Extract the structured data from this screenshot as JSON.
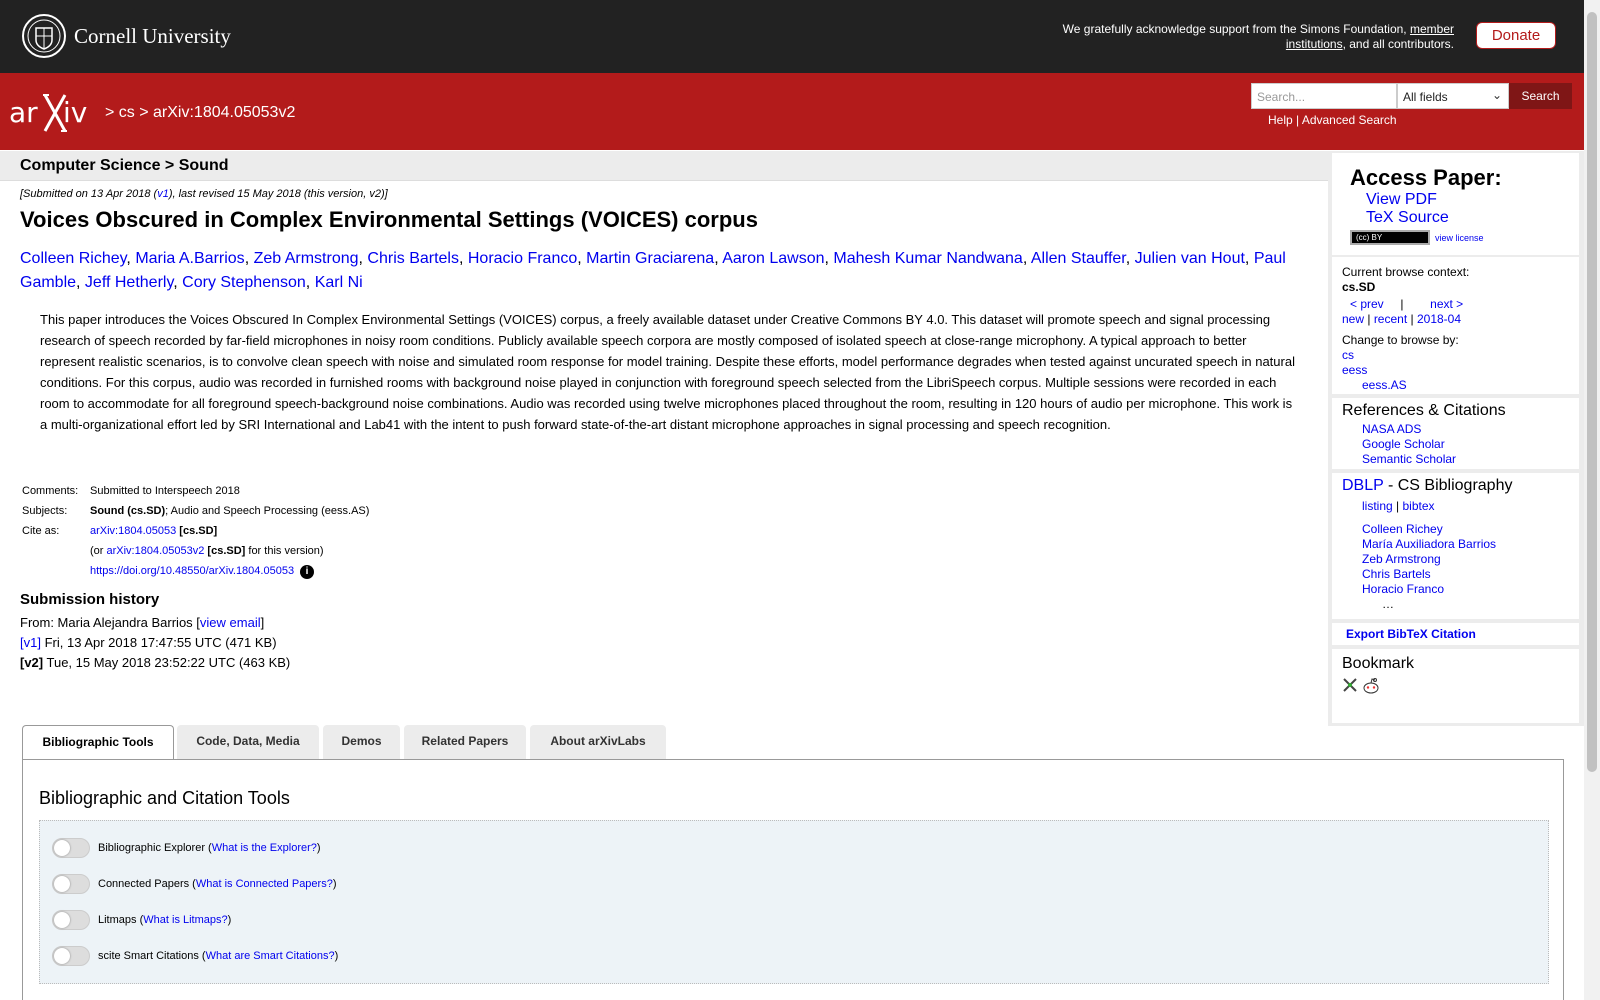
{
  "header": {
    "university": "Cornell University",
    "support_text_1": "We gratefully acknowledge support from the Simons Foundation,",
    "support_link": "member institutions",
    "support_text_2": ", and all contributors.",
    "donate": "Donate"
  },
  "nav": {
    "breadcrumbs": "> cs > arXiv:1804.05053v2",
    "search_placeholder": "Search...",
    "search_field": "All fields",
    "search_button": "Search",
    "help": "Help",
    "separator": "|",
    "advanced": "Advanced Search"
  },
  "subject": "Computer Science > Sound",
  "dateline": {
    "pre": "[Submitted on 13 Apr 2018 (",
    "v1": "v1",
    "post": "), last revised 15 May 2018 (this version, v2)]"
  },
  "title": "Voices Obscured in Complex Environmental Settings (VOICES) corpus",
  "authors": [
    "Colleen Richey",
    "Maria A.Barrios",
    "Zeb Armstrong",
    "Chris Bartels",
    "Horacio Franco",
    "Martin Graciarena",
    "Aaron Lawson",
    "Mahesh Kumar Nandwana",
    "Allen Stauffer",
    "Julien van Hout",
    "Paul Gamble",
    "Jeff Hetherly",
    "Cory Stephenson",
    "Karl Ni"
  ],
  "abstract": "This paper introduces the Voices Obscured In Complex Environmental Settings (VOICES) corpus, a freely available dataset under Creative Commons BY 4.0. This dataset will promote speech and signal processing research of speech recorded by far-field microphones in noisy room conditions. Publicly available speech corpora are mostly composed of isolated speech at close-range microphony. A typical approach to better represent realistic scenarios, is to convolve clean speech with noise and simulated room response for model training. Despite these efforts, model performance degrades when tested against uncurated speech in natural conditions. For this corpus, audio was recorded in furnished rooms with background noise played in conjunction with foreground speech selected from the LibriSpeech corpus. Multiple sessions were recorded in each room to accommodate for all foreground speech-background noise combinations. Audio was recorded using twelve microphones placed throughout the room, resulting in 120 hours of audio per microphone. This work is a multi-organizational effort led by SRI International and Lab41 with the intent to push forward state-of-the-art distant microphone approaches in signal processing and speech recognition.",
  "meta": {
    "comments_label": "Comments:",
    "comments": "Submitted to Interspeech 2018",
    "subjects_label": "Subjects:",
    "subject_primary": "Sound (cs.SD)",
    "subject_rest": "; Audio and Speech Processing (eess.AS)",
    "cite_label": "Cite as:",
    "cite_id": "arXiv:1804.05053",
    "cite_cat": "[cs.SD]",
    "cite2_pre": "(or ",
    "cite2_id": "arXiv:1804.05053v2",
    "cite2_cat": "[cs.SD]",
    "cite2_post": " for this version)",
    "doi": "https://doi.org/10.48550/arXiv.1804.05053"
  },
  "history": {
    "title": "Submission history",
    "from_pre": "From: Maria Alejandra Barrios [",
    "view_email": "view email",
    "from_post": "]",
    "v1_label": "[v1]",
    "v1_info": " Fri, 13 Apr 2018 17:47:55 UTC (471 KB)",
    "v2_label": "[v2]",
    "v2_info": " Tue, 15 May 2018 23:52:22 UTC (463 KB)"
  },
  "tabs": [
    "Bibliographic Tools",
    "Code, Data, Media",
    "Demos",
    "Related Papers",
    "About arXivLabs"
  ],
  "panel": {
    "title": "Bibliographic and Citation Tools",
    "tools": [
      {
        "name": "Bibliographic Explorer",
        "link": "What is the Explorer?"
      },
      {
        "name": "Connected Papers",
        "link": "What is Connected Papers?"
      },
      {
        "name": "Litmaps",
        "link": "What is Litmaps?"
      },
      {
        "name": "scite Smart Citations",
        "link": "What are Smart Citations?"
      }
    ]
  },
  "sidebar": {
    "access_title": "Access Paper:",
    "view_pdf": "View PDF",
    "tex_source": "TeX Source",
    "cc": "(cc) BY",
    "view_license": "view license",
    "context_label": "Current browse context:",
    "context": "cs.SD",
    "prev": "< prev",
    "pipe": "|",
    "next": "next >",
    "new": "new",
    "recent": "recent",
    "month": "2018-04",
    "change_label": "Change to browse by:",
    "browse": [
      "cs",
      "eess",
      "eess.AS"
    ],
    "refs_title": "References & Citations",
    "refs": [
      "NASA ADS",
      "Google Scholar",
      "Semantic Scholar"
    ],
    "dblp": "DBLP",
    "dblp_rest": " - CS Bibliography",
    "listing": "listing",
    "bibtex": "bibtex",
    "dblp_authors": [
      "Colleen Richey",
      "María Auxiliadora Barrios",
      "Zeb Armstrong",
      "Chris Bartels",
      "Horacio Franco"
    ],
    "ellipsis": "…",
    "export": "Export BibTeX Citation",
    "bookmark": "Bookmark"
  }
}
